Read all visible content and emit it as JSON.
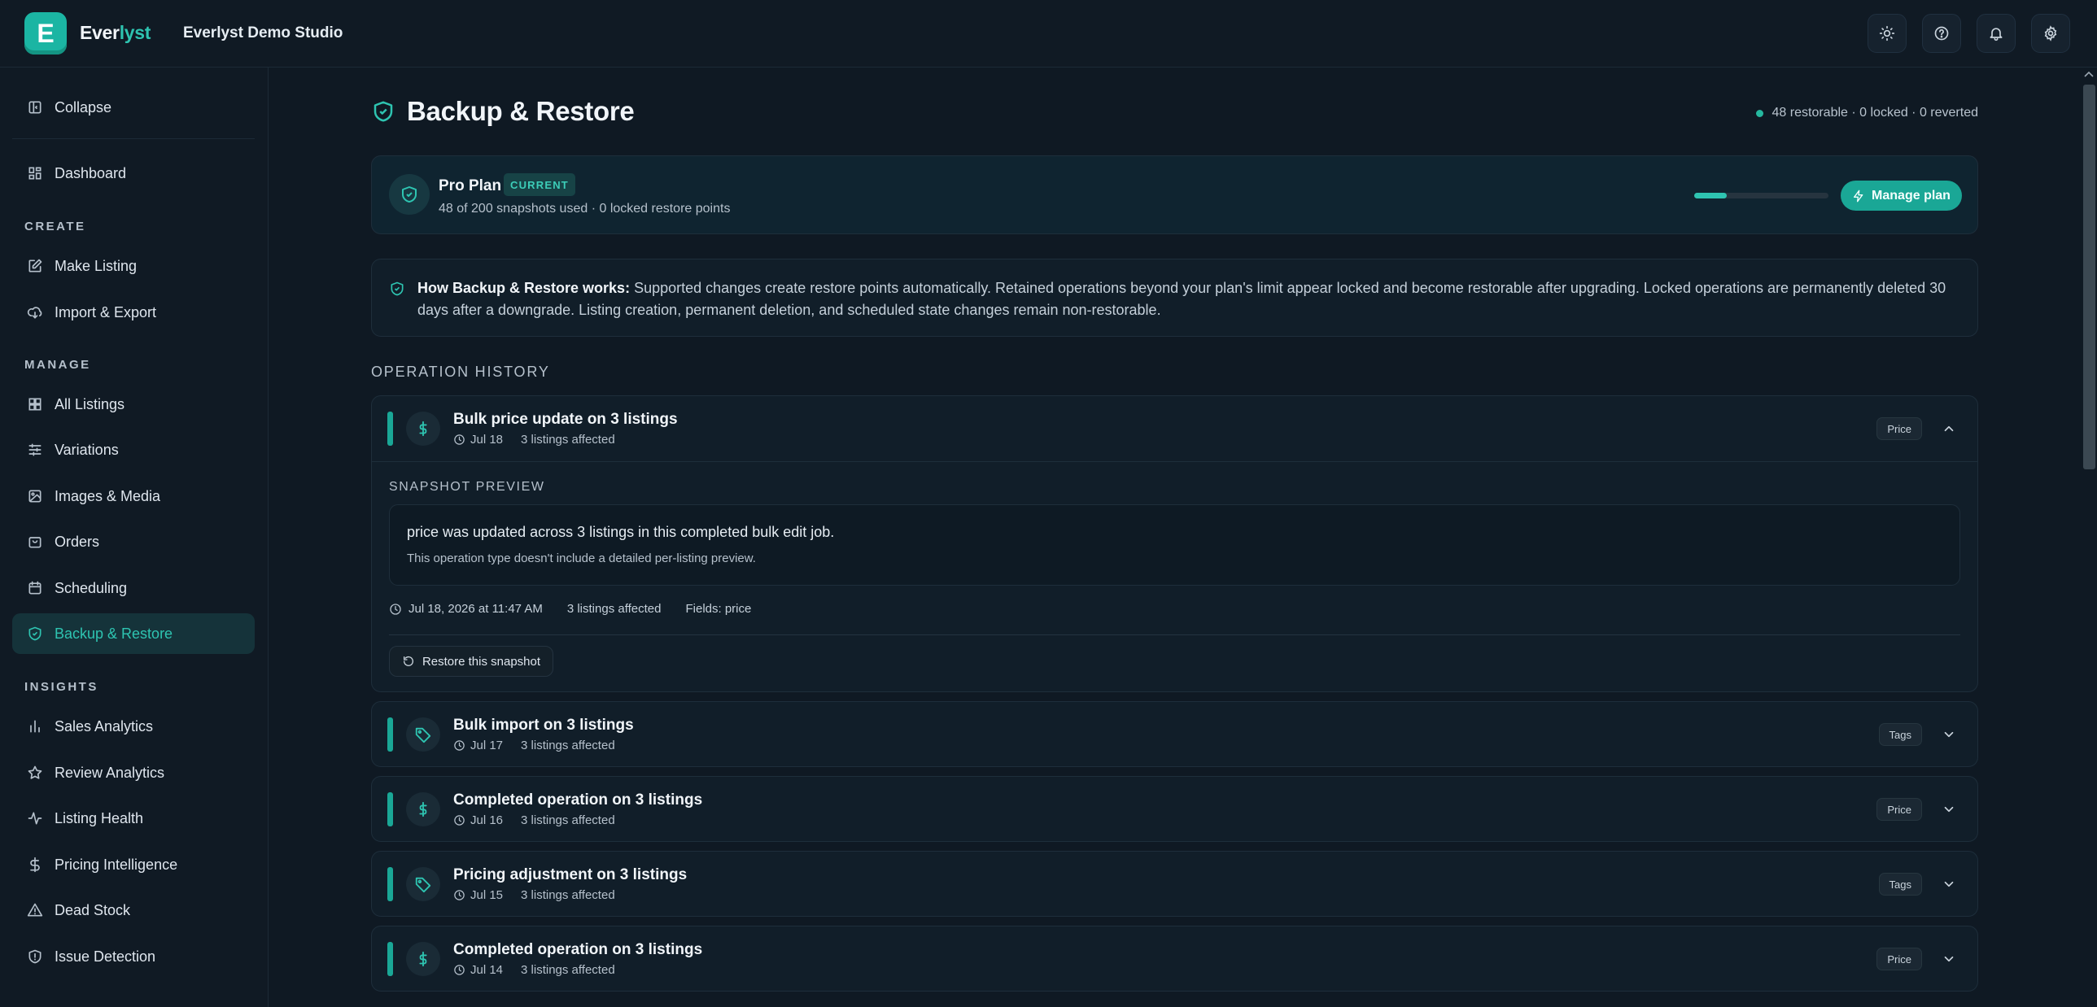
{
  "brand": {
    "logo_letter": "E",
    "name_part1": "Ever",
    "name_part2": "lyst",
    "studio": "Everlyst Demo Studio"
  },
  "topbar_icons": [
    "sun-icon",
    "help-icon",
    "bell-icon",
    "gear-icon"
  ],
  "sidebar": {
    "collapse": "Collapse",
    "dashboard": "Dashboard",
    "sections": {
      "create": "CREATE",
      "manage": "MANAGE",
      "insights": "INSIGHTS"
    },
    "create_items": [
      {
        "label": "Make Listing",
        "icon": "edit-icon"
      },
      {
        "label": "Import & Export",
        "icon": "cloud-sync-icon"
      }
    ],
    "manage_items": [
      {
        "label": "All Listings",
        "icon": "grid-icon"
      },
      {
        "label": "Variations",
        "icon": "sliders-icon"
      },
      {
        "label": "Images & Media",
        "icon": "image-icon"
      },
      {
        "label": "Orders",
        "icon": "bag-icon"
      },
      {
        "label": "Scheduling",
        "icon": "calendar-icon"
      },
      {
        "label": "Backup & Restore",
        "icon": "shield-icon",
        "active": true
      }
    ],
    "insight_items": [
      {
        "label": "Sales Analytics",
        "icon": "bar-chart-icon"
      },
      {
        "label": "Review Analytics",
        "icon": "star-icon"
      },
      {
        "label": "Listing Health",
        "icon": "pulse-icon"
      },
      {
        "label": "Pricing Intelligence",
        "icon": "dollar-icon"
      },
      {
        "label": "Dead Stock",
        "icon": "warning-icon"
      },
      {
        "label": "Issue Detection",
        "icon": "shield-alert-icon"
      }
    ]
  },
  "page": {
    "title": "Backup & Restore",
    "status": "48 restorable · 0 locked · 0 reverted"
  },
  "plan": {
    "name": "Pro Plan",
    "badge": "CURRENT",
    "usage": "48 of 200 snapshots used · 0 locked restore points",
    "usage_fraction": 0.24,
    "manage_label": "Manage plan"
  },
  "info": {
    "heading": "How Backup & Restore works:",
    "body": " Supported changes create restore points automatically. Retained operations beyond your plan's limit appear locked and become restorable after upgrading. Locked operations are permanently deleted 30 days after a downgrade. Listing creation, permanent deletion, and scheduled state changes remain non-restorable."
  },
  "history": {
    "label": "OPERATION HISTORY",
    "operations": [
      {
        "title": "Bulk price update on 3 listings",
        "date": "Jul 18",
        "count": "3 listings affected",
        "tag": "Price",
        "icon": "dollar-icon",
        "expanded": true
      },
      {
        "title": "Bulk import on 3 listings",
        "date": "Jul 17",
        "count": "3 listings affected",
        "tag": "Tags",
        "icon": "tag-icon"
      },
      {
        "title": "Completed operation on 3 listings",
        "date": "Jul 16",
        "count": "3 listings affected",
        "tag": "Price",
        "icon": "dollar-icon"
      },
      {
        "title": "Pricing adjustment on 3 listings",
        "date": "Jul 15",
        "count": "3 listings affected",
        "tag": "Tags",
        "icon": "tag-icon"
      },
      {
        "title": "Completed operation on 3 listings",
        "date": "Jul 14",
        "count": "3 listings affected",
        "tag": "Price",
        "icon": "dollar-icon"
      }
    ],
    "snapshot": {
      "label": "SNAPSHOT PREVIEW",
      "main": "price was updated across 3 listings in this completed bulk edit job.",
      "sub": "This operation type doesn't include a detailed per-listing preview.",
      "timestamp": "Jul 18, 2026 at 11:47 AM",
      "count": "3 listings affected",
      "fields": "Fields: price",
      "restore_label": "Restore this snapshot"
    }
  },
  "colors": {
    "accent": "#2ec4b1",
    "background": "#0f1923",
    "card": "#111e29"
  }
}
